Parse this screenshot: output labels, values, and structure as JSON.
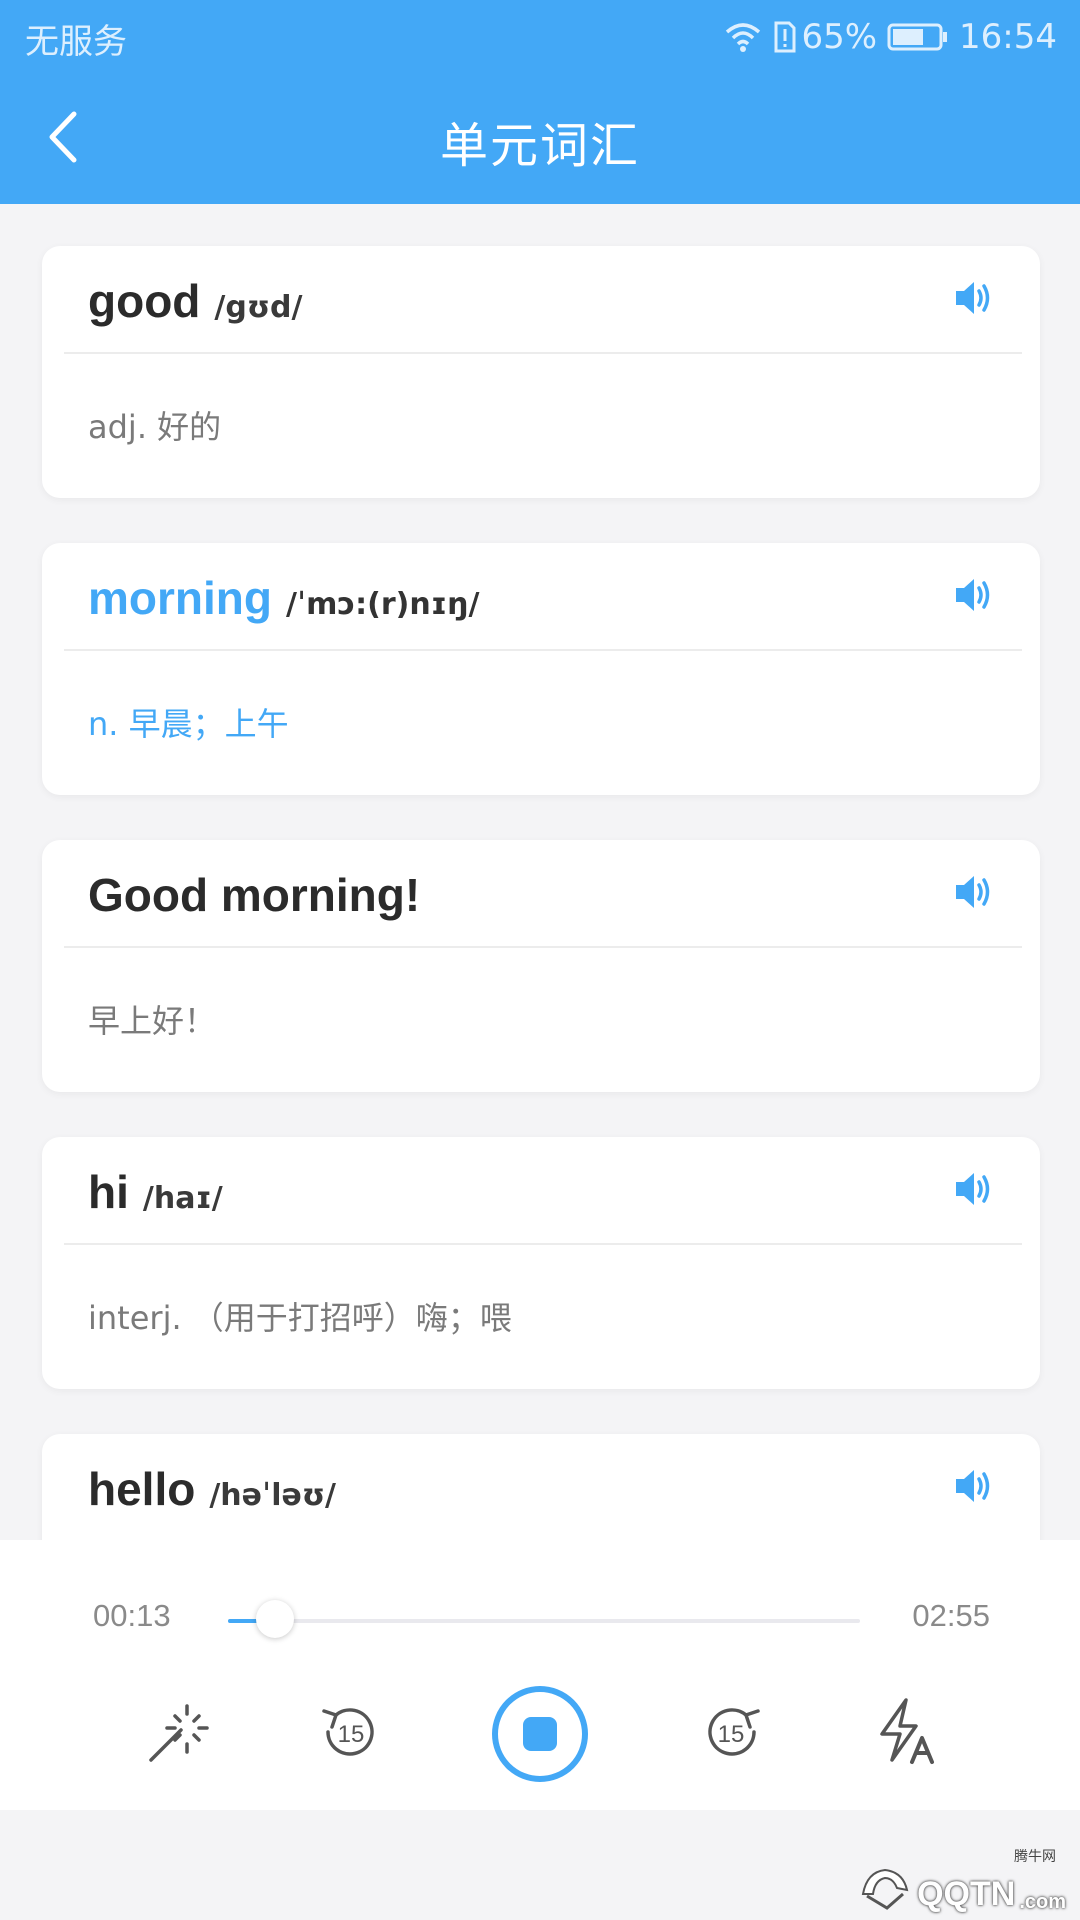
{
  "status_bar": {
    "carrier": "无服务",
    "battery": "65%",
    "time": "16:54",
    "icons": [
      "wifi-icon",
      "sim-alert-icon",
      "battery-icon"
    ]
  },
  "header": {
    "title": "单元词汇",
    "back_icon": "chevron-left-icon",
    "color": "#43a8f6"
  },
  "vocab": [
    {
      "word": "good",
      "phonetic": "/gʊd/",
      "meaning": "adj. 好的",
      "active": false
    },
    {
      "word": "morning",
      "phonetic": "/ˈmɔ:(r)nɪŋ/",
      "meaning": "n. 早晨；上午",
      "active": true
    },
    {
      "word": "Good morning!",
      "phonetic": "",
      "meaning": "早上好！",
      "active": false
    },
    {
      "word": "hi",
      "phonetic": "/haɪ/",
      "meaning": "interj. （用于打招呼）嗨；喂",
      "active": false
    },
    {
      "word": "hello",
      "phonetic": "/həˈləʊ/",
      "meaning": "",
      "active": false
    }
  ],
  "player": {
    "current_time": "00:13",
    "total_time": "02:55",
    "progress": 0.074,
    "controls": [
      "magic-wand-icon",
      "rewind-15-icon",
      "stop-icon",
      "forward-15-icon",
      "auto-speed-icon"
    ],
    "rewind_label": "15",
    "forward_label": "15",
    "accent": "#43a8f6"
  },
  "watermark": {
    "text": "QQTN",
    "sub": ".com",
    "small": "腾牛网"
  }
}
